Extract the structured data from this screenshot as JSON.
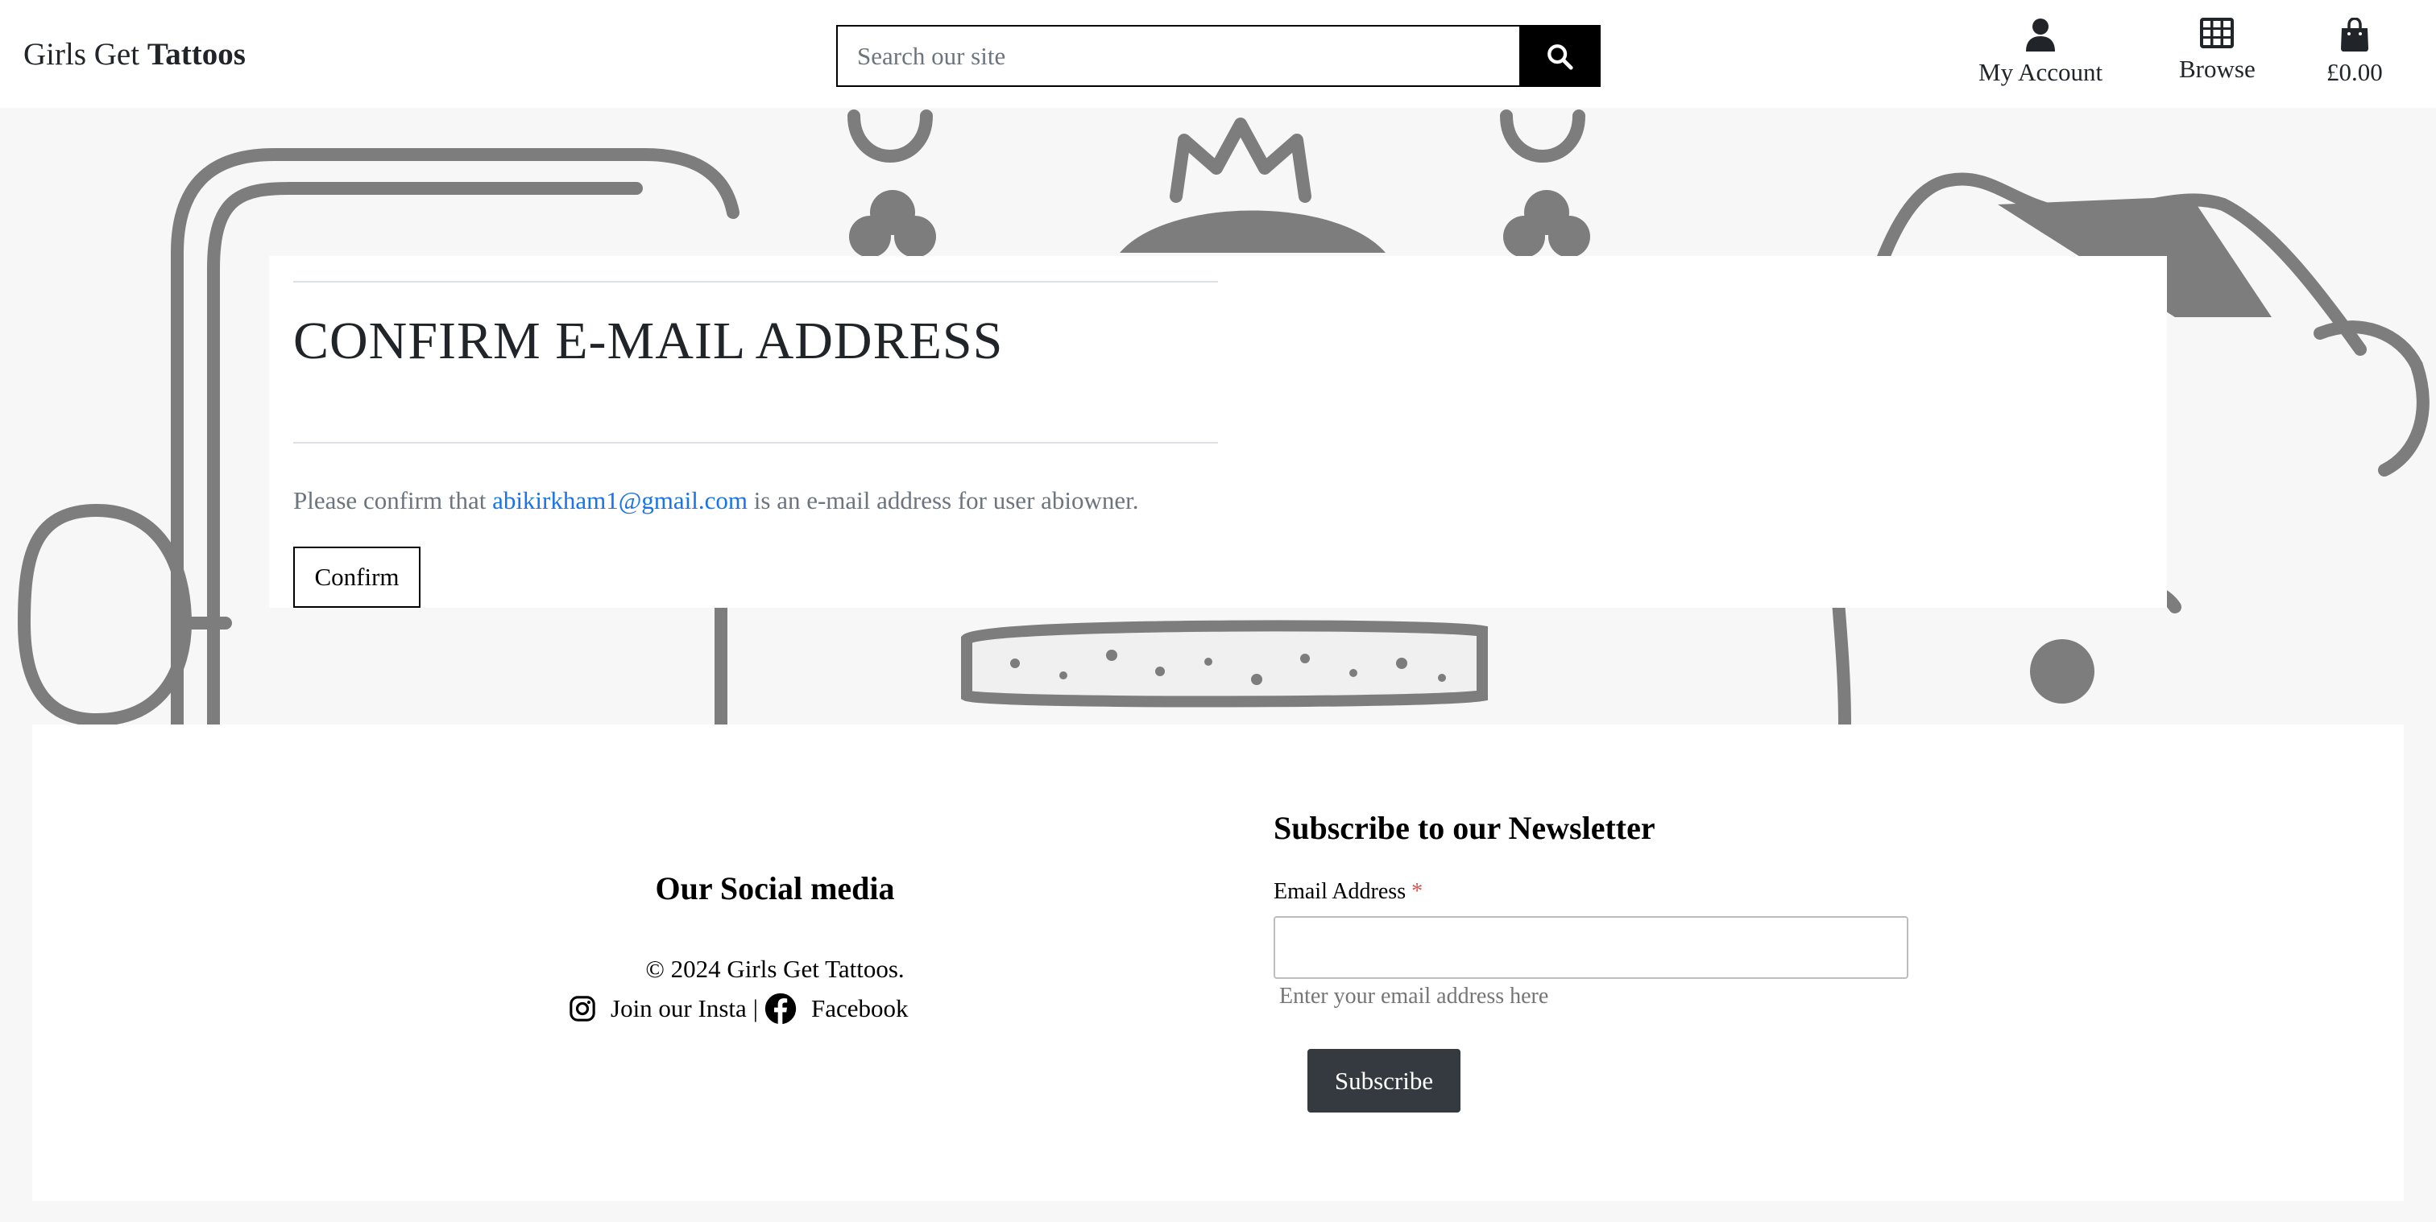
{
  "header": {
    "brand_prefix": "Girls Get ",
    "brand_bold": "Tattoos",
    "search_placeholder": "Search our site",
    "nav": {
      "account_label": "My Account",
      "browse_label": "Browse",
      "bag_total": "£0.00"
    }
  },
  "main": {
    "title": "CONFIRM E-MAIL ADDRESS",
    "confirm_prefix": "Please confirm that ",
    "email": "abikirkham1@gmail.com",
    "confirm_suffix": " is an e-mail address for user abiowner.",
    "confirm_button": "Confirm"
  },
  "footer": {
    "social_title": "Our Social media",
    "copyright": "© 2024 Girls Get Tattoos.",
    "insta_label": "Join our Insta",
    "separator": "|",
    "facebook_label": "Facebook",
    "newsletter_title": "Subscribe to our Newsletter",
    "email_label": "Email Address",
    "required_mark": "*",
    "email_help": "Enter your email address here",
    "subscribe_button": "Subscribe"
  },
  "colors": {
    "accent_link": "#1a73e8",
    "dark_button": "#343a40",
    "required": "#d9534f"
  },
  "icons": [
    "search-icon",
    "user-icon",
    "grid-icon",
    "shopping-bag-icon",
    "instagram-icon",
    "facebook-icon"
  ]
}
